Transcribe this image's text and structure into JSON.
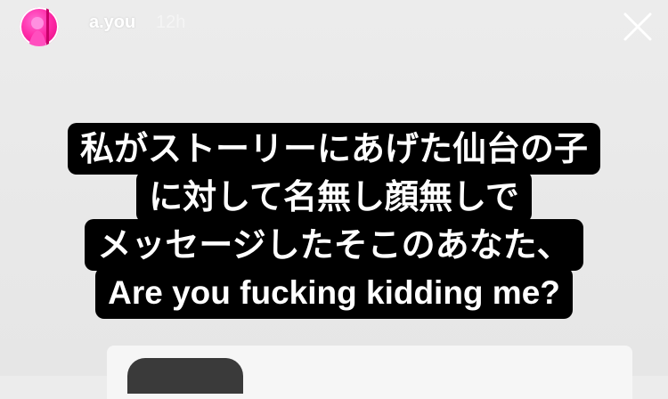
{
  "story": {
    "username": "a.you",
    "time": "12h",
    "caption_lines": [
      "私がストーリーにあげた仙台の子",
      "に対して名無し顔無しで",
      "メッセージしたそこのあなた、",
      "Are you fucking kidding me?"
    ],
    "icons": {
      "avatar": "avatar-image",
      "close": "close-icon"
    }
  }
}
